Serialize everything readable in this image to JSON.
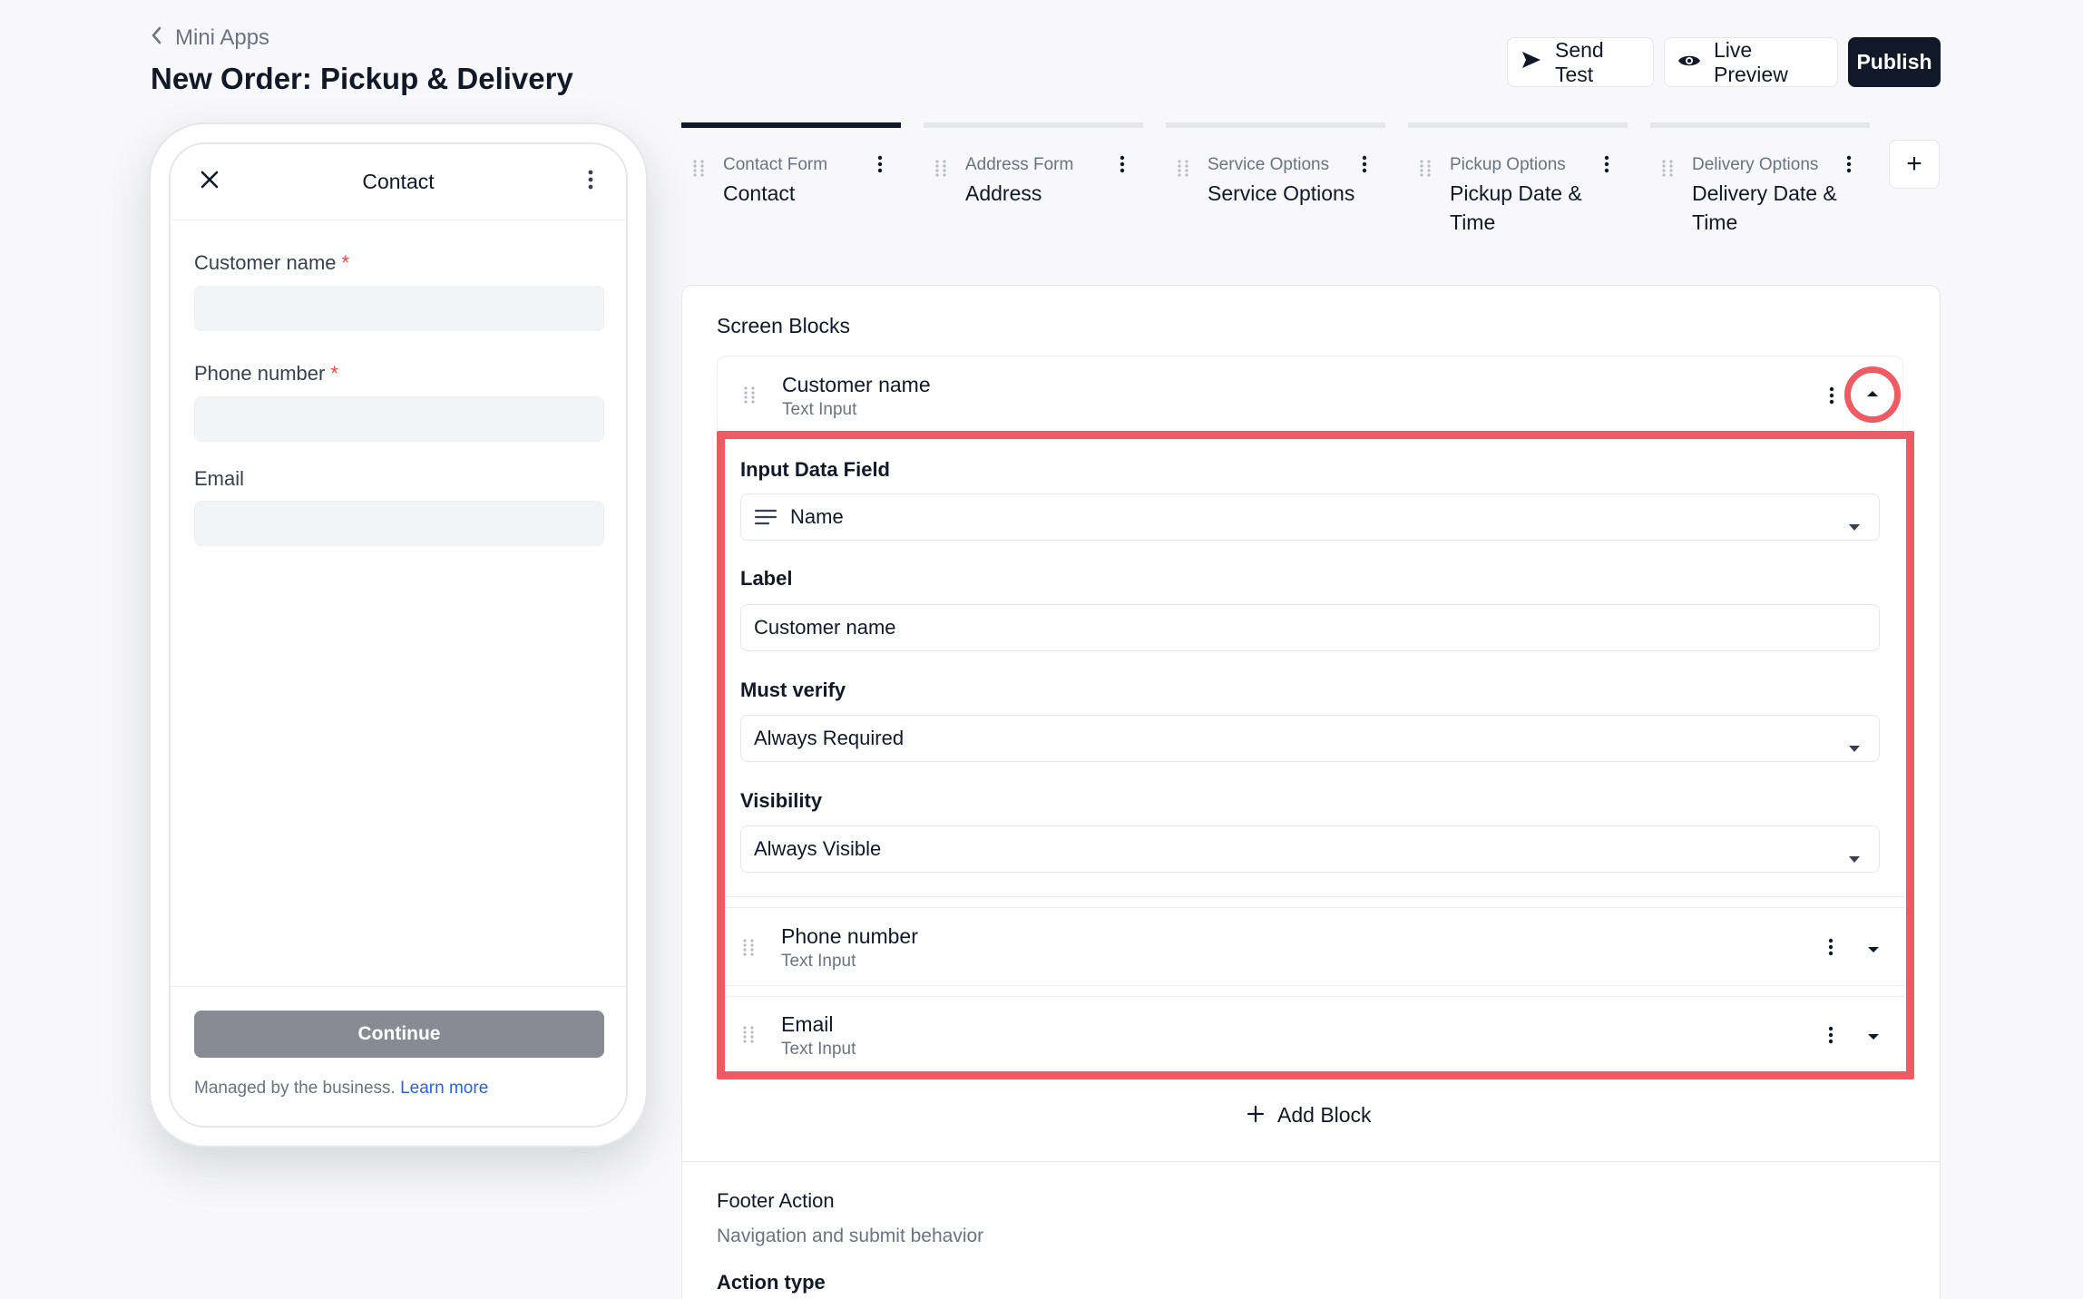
{
  "header": {
    "back_label": "Mini Apps",
    "title": "New Order: Pickup & Delivery",
    "send_test": "Send Test",
    "live_preview": "Live Preview",
    "publish": "Publish"
  },
  "phone": {
    "screen_title": "Contact",
    "fields": [
      {
        "label": "Customer name",
        "required": "*"
      },
      {
        "label": "Phone number",
        "required": "*"
      },
      {
        "label": "Email",
        "required": ""
      }
    ],
    "continue": "Continue",
    "managed_text": "Managed by the business.",
    "learn_more": "Learn more"
  },
  "tabs": [
    {
      "kind": "Contact Form",
      "name": "Contact",
      "active": true
    },
    {
      "kind": "Address Form",
      "name": "Address",
      "active": false
    },
    {
      "kind": "Service Options",
      "name": "Service Options",
      "active": false
    },
    {
      "kind": "Pickup Options",
      "name": "Pickup Date & Time",
      "active": false
    },
    {
      "kind": "Delivery Options",
      "name": "Delivery Date & Time",
      "active": false
    }
  ],
  "tab_add": "+",
  "panel": {
    "screen_blocks_title": "Screen Blocks",
    "blocks": [
      {
        "name": "Customer name",
        "type": "Text Input"
      },
      {
        "name": "Phone number",
        "type": "Text Input"
      },
      {
        "name": "Email",
        "type": "Text Input"
      }
    ],
    "expanded": {
      "input_data_field_label": "Input Data Field",
      "input_data_field_value": "Name",
      "label_label": "Label",
      "label_value": "Customer name",
      "must_verify_label": "Must verify",
      "must_verify_value": "Always Required",
      "visibility_label": "Visibility",
      "visibility_value": "Always Visible"
    },
    "add_block": "Add Block",
    "footer_title": "Footer Action",
    "footer_sub": "Navigation and submit behavior",
    "action_type_label": "Action type"
  },
  "colors": {
    "highlight": "#ef5a63",
    "primary": "#111827",
    "link": "#2563eb",
    "required": "#ef4444"
  }
}
